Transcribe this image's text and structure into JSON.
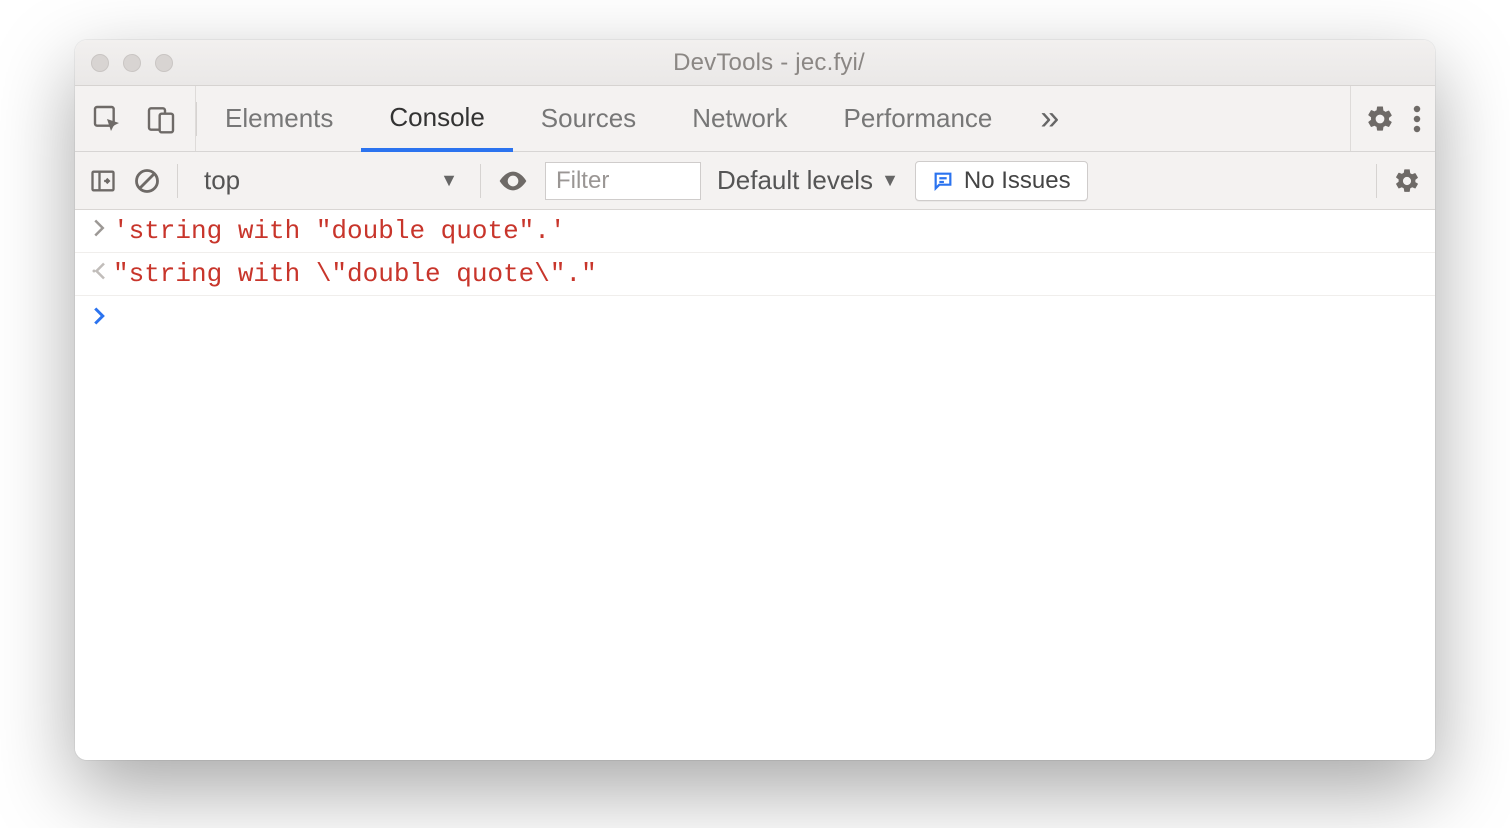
{
  "window": {
    "title": "DevTools - jec.fyi/"
  },
  "tabs": {
    "items": [
      "Elements",
      "Console",
      "Sources",
      "Network",
      "Performance"
    ],
    "active_index": 1,
    "overflow_glyph": "»"
  },
  "toolbar": {
    "context": "top",
    "filter_placeholder": "Filter",
    "levels_label": "Default levels",
    "issues_label": "No Issues"
  },
  "console": {
    "entries": [
      {
        "kind": "input",
        "text": "'string with \"double quote\".'"
      },
      {
        "kind": "output",
        "text": "\"string with \\\"double quote\\\".\""
      }
    ]
  }
}
